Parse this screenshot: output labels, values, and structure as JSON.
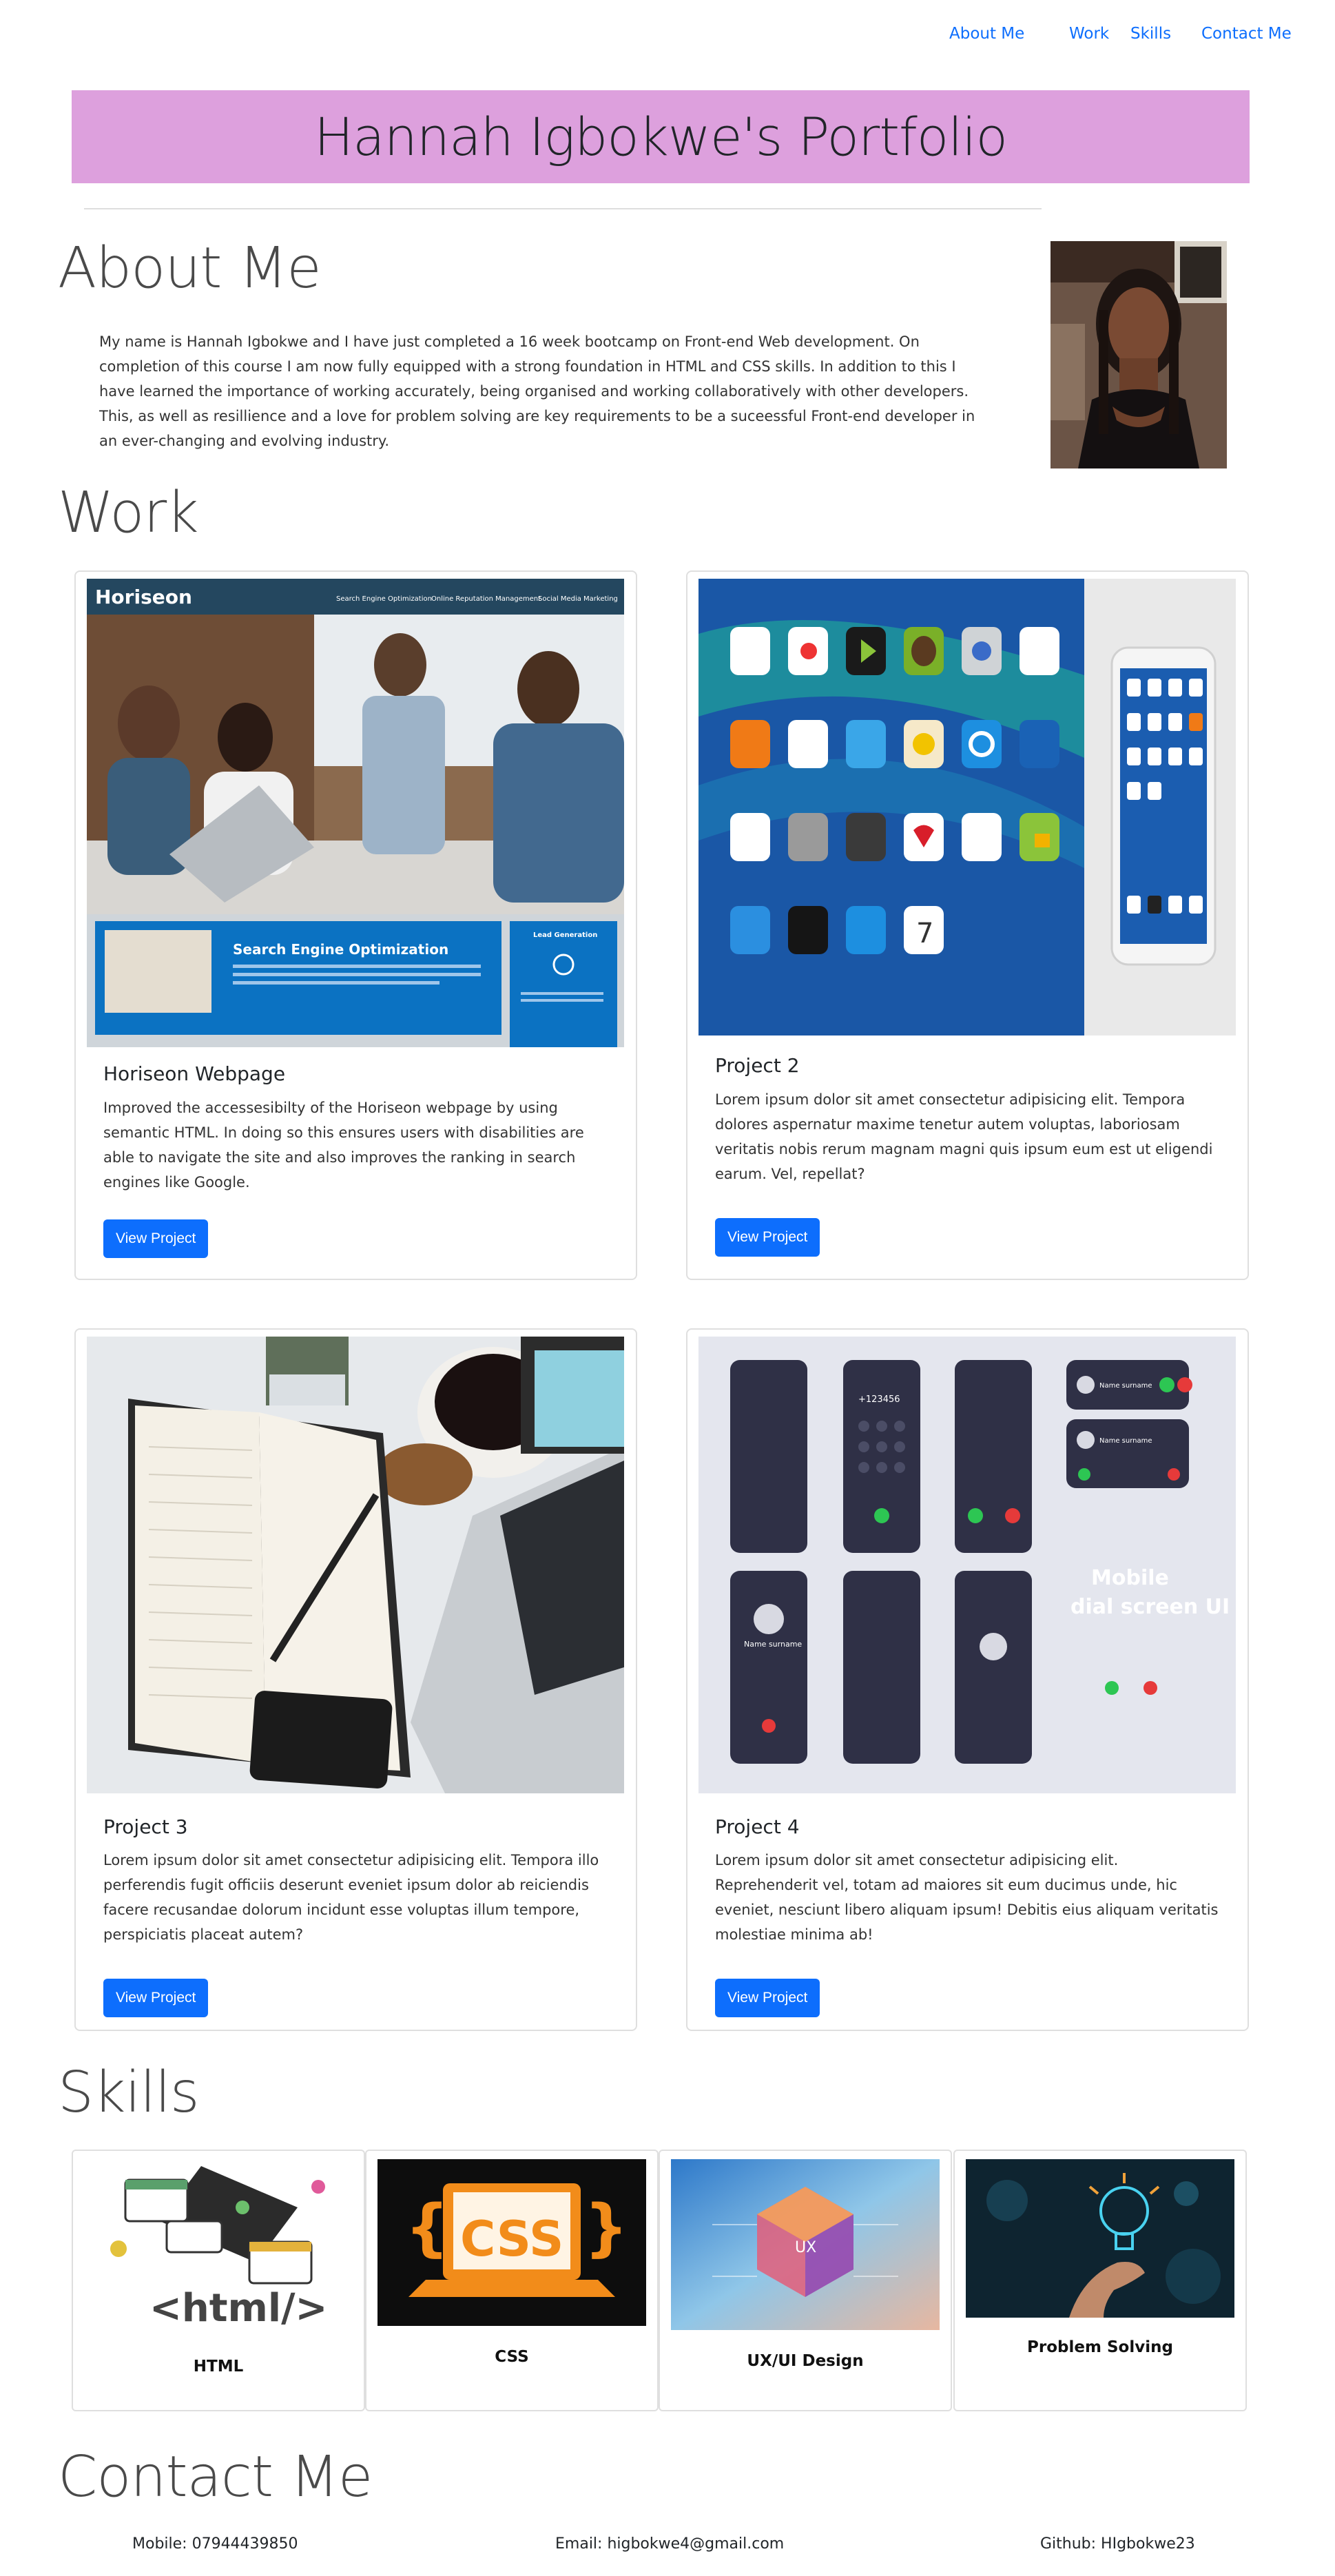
{
  "nav": {
    "items": [
      "About Me",
      "Work",
      "Skills",
      "Contact Me"
    ]
  },
  "header": {
    "title": "Hannah Igbokwe's Portfolio"
  },
  "about": {
    "heading": "About Me",
    "text": "My name is Hannah Igbokwe and I have just completed a 16 week bootcamp on Front-end Web development. On completion of this course I am now fully equipped with a strong foundation in HTML and CSS skills. In addition to this I have learned the importance of working accurately, being organised and working collaboratively with other developers. This, as well as resillience and a love for problem solving are key requirements to be a suceessful Front-end developer in an ever-changing and evolving industry."
  },
  "work": {
    "heading": "Work",
    "button_label": "View Project",
    "projects": [
      {
        "title": "Horiseon Webpage",
        "description": "Improved the accessesibilty of the Horiseon webpage by using semantic HTML. In doing so this ensures users with disabilities are able to navigate the site and also improves the ranking in search engines like Google.",
        "image_text": {
          "brand": "Horiseon",
          "links": [
            "Search Engine Optimization",
            "Online Reputation Management",
            "Social Media Marketing"
          ],
          "feature": "Search Engine Optimization",
          "side": "Lead Generation"
        }
      },
      {
        "title": "Project 2",
        "description": "Lorem ipsum dolor sit amet consectetur adipisicing elit. Tempora dolores aspernatur maxime tenetur autem voluptas, laboriosam veritatis nobis rerum magnam magni quis ipsum eum est ut eligendi earum. Vel, repellat?"
      },
      {
        "title": "Project 3",
        "description": "Lorem ipsum dolor sit amet consectetur adipisicing elit. Tempora illo perferendis fugit officiis deserunt eveniet ipsum dolor ab reiciendis facere recusandae dolorum incidunt esse voluptas illum tempore, perspiciatis placeat autem?"
      },
      {
        "title": "Project 4",
        "description": "Lorem ipsum dolor sit amet consectetur adipisicing elit. Reprehenderit vel, totam ad maiores sit eum ducimus unde, hic eveniet, nesciunt libero aliquam ipsum! Debitis eius aliquam veritatis molestiae minima ab!",
        "image_text": {
          "title1": "Mobile",
          "title2": "dial screen UI",
          "number": "+123456",
          "name": "Name surname"
        }
      }
    ]
  },
  "skills": {
    "heading": "Skills",
    "items": [
      {
        "label": "HTML",
        "image_text": "<html/>"
      },
      {
        "label": "CSS",
        "image_text": "CSS"
      },
      {
        "label": "UX/UI Design",
        "image_text": "UX"
      },
      {
        "label": "Problem Solving"
      }
    ]
  },
  "contact": {
    "heading": "Contact Me",
    "mobile": "Mobile: 07944439850",
    "email": "Email: higbokwe4@gmail.com",
    "github": "Github: HIgbokwe23"
  },
  "colors": {
    "banner": "#dda0dd",
    "accent": "#0d6efd"
  }
}
